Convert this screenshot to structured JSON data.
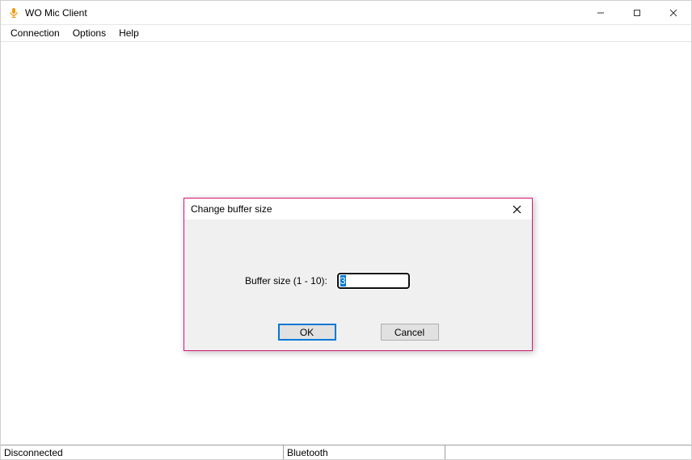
{
  "window": {
    "title": "WO Mic Client"
  },
  "menu": {
    "connection": "Connection",
    "options": "Options",
    "help": "Help"
  },
  "dialog": {
    "title": "Change buffer size",
    "label": "Buffer size (1 - 10):",
    "value": "3",
    "ok": "OK",
    "cancel": "Cancel"
  },
  "status": {
    "panel1": "Disconnected",
    "panel2": "Bluetooth",
    "panel3": ""
  }
}
